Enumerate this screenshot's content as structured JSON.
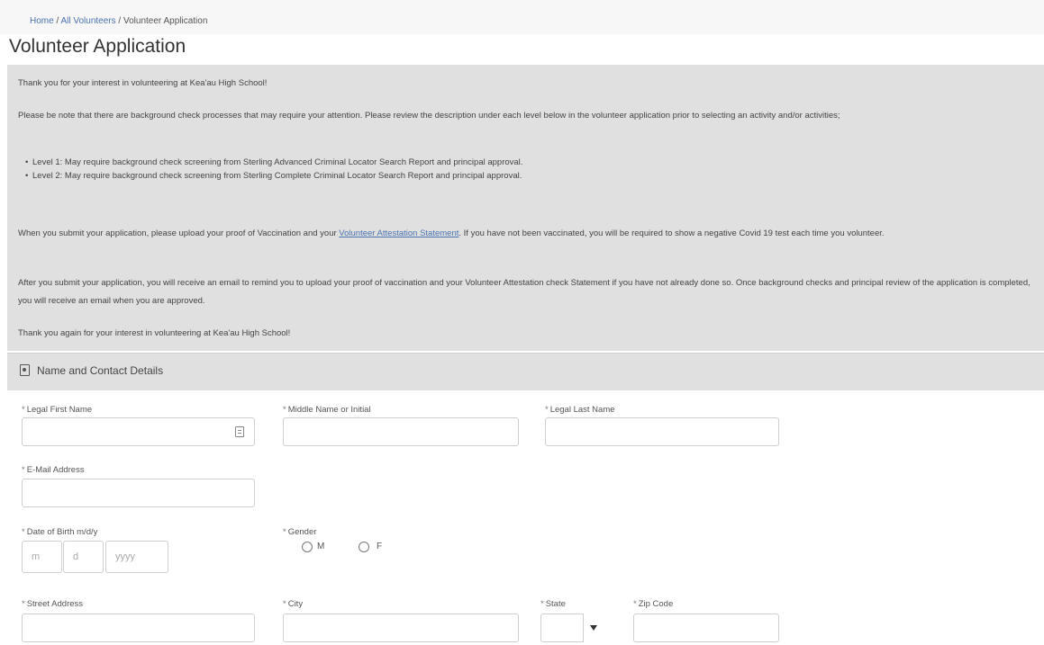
{
  "breadcrumb": {
    "home": "Home",
    "all_volunteers": "All Volunteers",
    "current": "Volunteer Application",
    "separator": " / "
  },
  "page": {
    "title": "Volunteer Application"
  },
  "intro": {
    "thanks": "Thank you for your interest in volunteering at Kea'au High School!",
    "notice": "Please be note that there are background check processes that may require your attention. Please review the description under each level below in the volunteer application prior to selecting an activity and/or activities;",
    "levels": [
      "Level 1: May require background check screening from Sterling Advanced Criminal Locator Search Report and principal approval.",
      "Level 2: May require background check screening from Sterling Complete Criminal Locator Search Report and principal approval."
    ],
    "upload_before": "When you submit your application, please upload your proof of Vaccination and your ",
    "upload_link": "Volunteer Attestation Statement",
    "upload_after": ". If you have not been vaccinated, you will be required to show a negative Covid 19 test each time you volunteer.",
    "after_submit": "After you submit your application, you will receive an email to remind you to upload your proof of vaccination and your Volunteer Attestation check Statement if you have not already done so. Once background checks and principal review of the application is completed, you will receive an email when you are approved.",
    "thanks_again": "Thank you again for your interest in volunteering at Kea'au High School!"
  },
  "section": {
    "title": "Name and Contact Details",
    "icon": "contact-card-icon"
  },
  "form": {
    "required_mark": "*",
    "first_name": {
      "label": "Legal First Name",
      "value": ""
    },
    "middle_name": {
      "label": "Middle Name or Initial",
      "value": ""
    },
    "last_name": {
      "label": "Legal Last Name",
      "value": ""
    },
    "email": {
      "label": "E-Mail Address",
      "value": ""
    },
    "dob": {
      "label": "Date of Birth m/d/y",
      "month_placeholder": "m",
      "day_placeholder": "d",
      "year_placeholder": "yyyy",
      "sep": "/"
    },
    "gender": {
      "label": "Gender",
      "options": [
        "M",
        "F"
      ]
    },
    "street": {
      "label": "Street Address",
      "value": ""
    },
    "city": {
      "label": "City",
      "value": ""
    },
    "state": {
      "label": "State",
      "value": ""
    },
    "zip": {
      "label": "Zip Code",
      "value": ""
    }
  },
  "colors": {
    "link": "#4a73b0",
    "panel": "#e0e0e0",
    "border": "#cfcfcf"
  }
}
